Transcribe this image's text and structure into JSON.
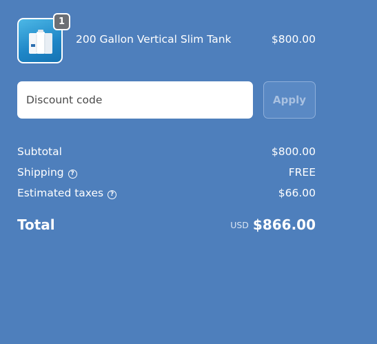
{
  "line_item": {
    "quantity": "1",
    "name": "200 Gallon Vertical Slim Tank",
    "price": "$800.00"
  },
  "discount": {
    "placeholder": "Discount code",
    "apply_label": "Apply"
  },
  "summary": {
    "subtotal_label": "Subtotal",
    "subtotal_value": "$800.00",
    "shipping_label": "Shipping",
    "shipping_value": "FREE",
    "taxes_label": "Estimated taxes",
    "taxes_value": "$66.00",
    "help_glyph": "?"
  },
  "total": {
    "label": "Total",
    "currency": "USD",
    "value": "$866.00"
  },
  "icons": {
    "shipping_help": "question-circle-icon",
    "taxes_help": "question-circle-icon"
  },
  "colors": {
    "background": "#4e7fbc",
    "badge": "#6b6f75",
    "text": "#ffffff"
  }
}
